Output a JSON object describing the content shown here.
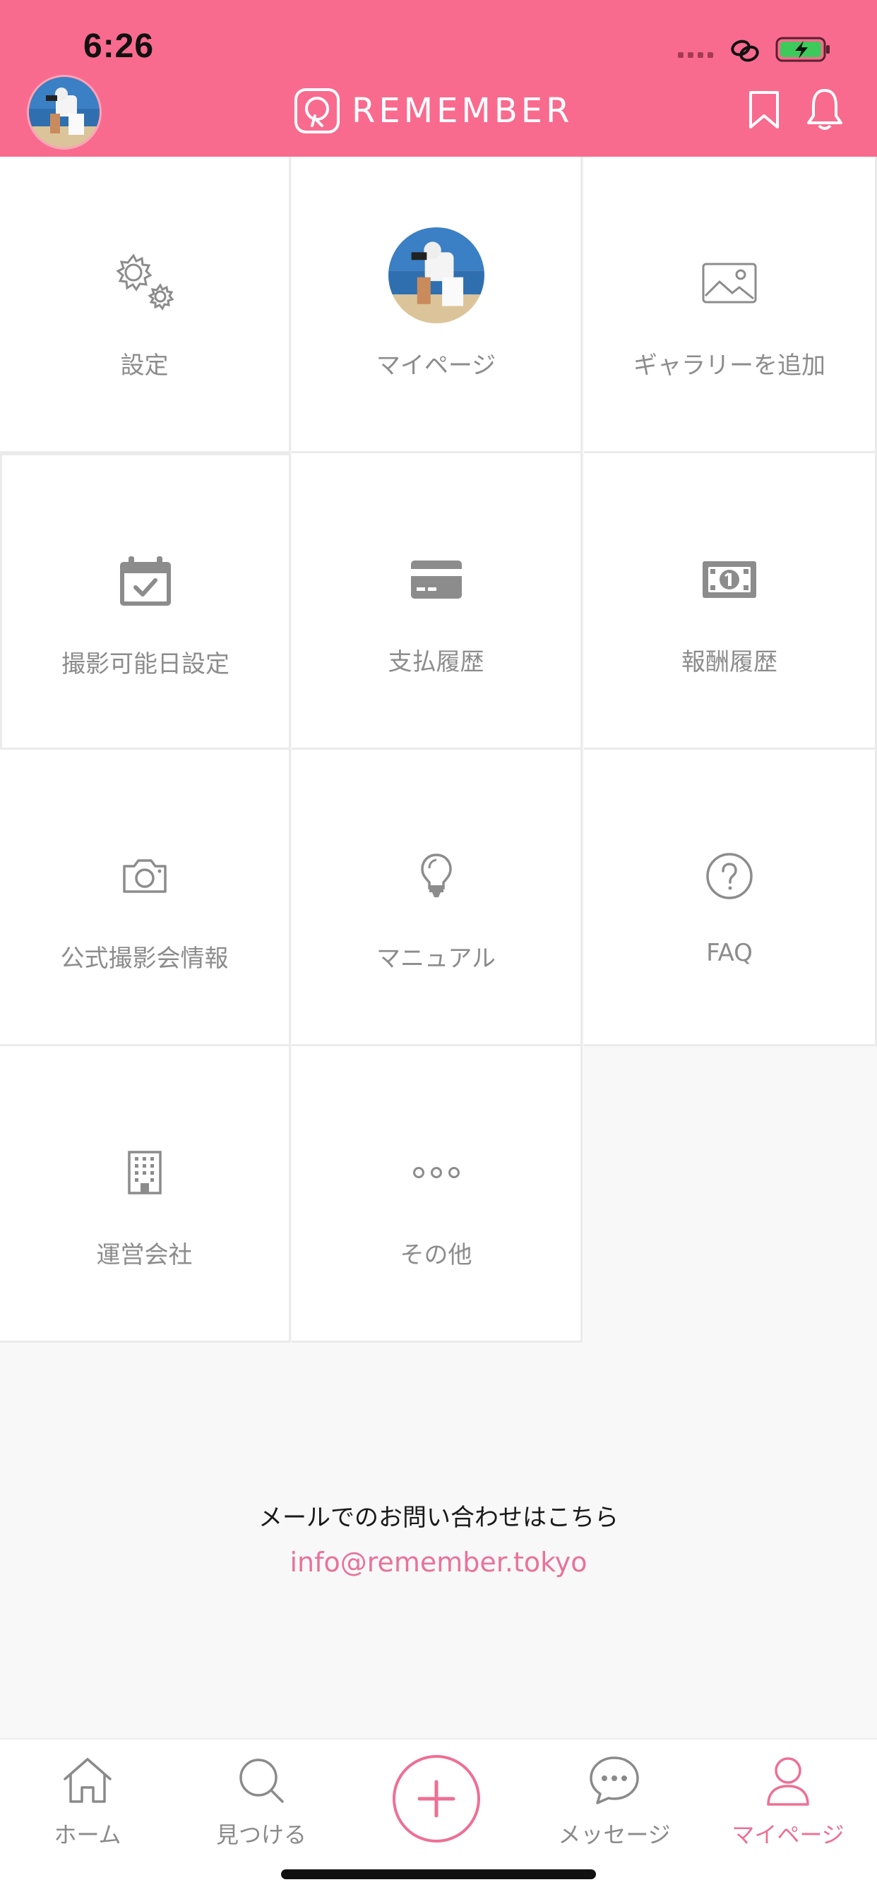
{
  "status_bar": {
    "time": "6:26"
  },
  "header": {
    "logo_text": "REMEMBER"
  },
  "colors": {
    "brand": "#f86b8e",
    "accent": "#ee6f94",
    "label_gray": "#8c8c8c"
  },
  "menu": {
    "settings": "設定",
    "mypage": "マイページ",
    "add_gallery": "ギャラリーを追加",
    "availability": "撮影可能日設定",
    "payment_history": "支払履歴",
    "reward_history": "報酬履歴",
    "official_events": "公式撮影会情報",
    "manual": "マニュアル",
    "faq": "FAQ",
    "company": "運営会社",
    "other": "その他"
  },
  "contact": {
    "text": "メールでのお問い合わせはこちら",
    "email": "info@remember.tokyo"
  },
  "tabs": {
    "home": "ホーム",
    "find": "見つける",
    "messages": "メッセージ",
    "mypage": "マイページ",
    "active": "mypage"
  },
  "icons": {
    "header": [
      "avatar",
      "logo-icon",
      "bookmark-icon",
      "bell-icon"
    ],
    "menu": [
      "gears-icon",
      "avatar",
      "image-icon",
      "calendar-check-icon",
      "credit-card-icon",
      "banknote-icon",
      "camera-icon",
      "lightbulb-icon",
      "question-circle-icon",
      "building-icon",
      "more-dots-icon"
    ],
    "tabs": [
      "home-icon",
      "search-icon",
      "plus-icon",
      "chat-bubble-icon",
      "person-icon"
    ]
  }
}
